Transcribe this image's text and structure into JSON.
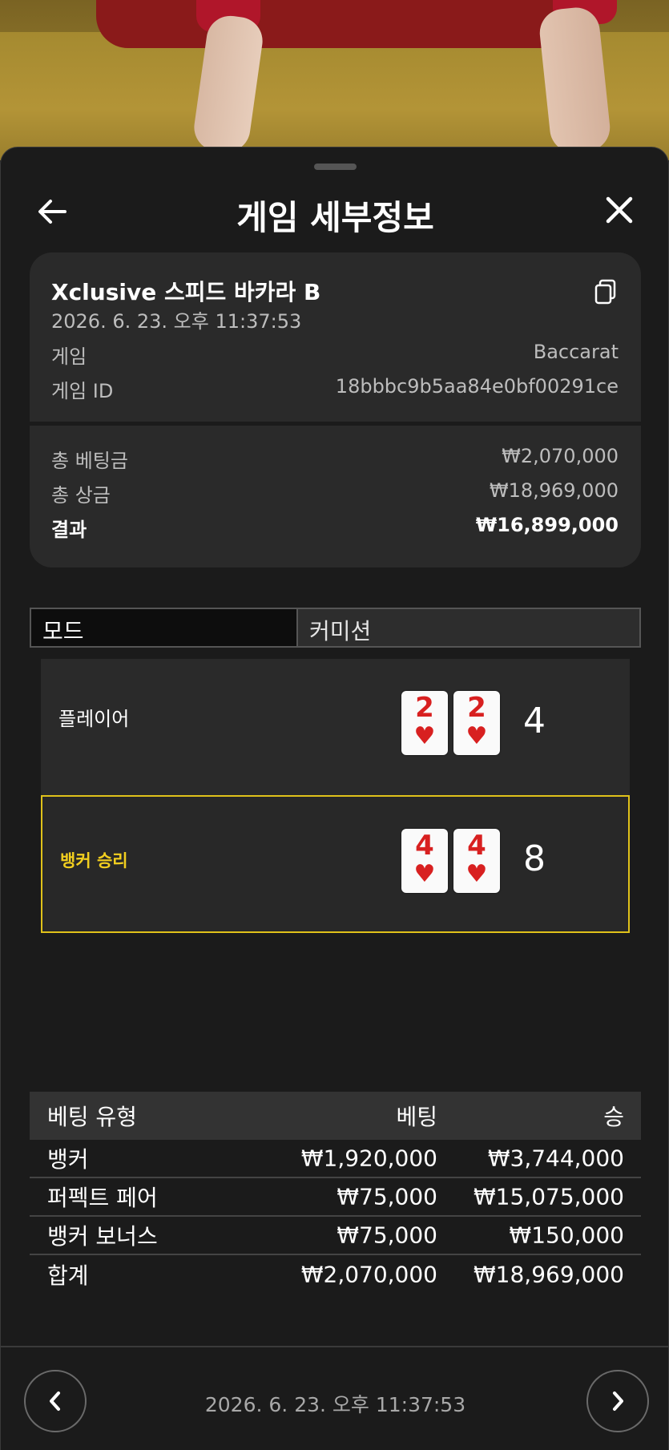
{
  "header": {
    "title": "게임 세부정보"
  },
  "info": {
    "game_name": "Xclusive 스피드 바카라 B",
    "datetime": "2026. 6. 23. 오후 11:37:53",
    "game_label": "게임",
    "game_value": "Baccarat",
    "game_id_label": "게임 ID",
    "game_id_value": "18bbbc9b5aa84e0bf00291ce"
  },
  "summary": {
    "total_bet_label": "총 베팅금",
    "total_bet_value": "₩2,070,000",
    "total_win_label": "총 상금",
    "total_win_value": "₩18,969,000",
    "result_label": "결과",
    "result_value": "₩16,899,000"
  },
  "tabs": [
    {
      "label": "모드",
      "active": true
    },
    {
      "label": "커미션",
      "active": false
    }
  ],
  "result": {
    "player": {
      "label": "플레이어",
      "cards": [
        {
          "rank": "2",
          "suit": "♥"
        },
        {
          "rank": "2",
          "suit": "♥"
        }
      ],
      "score": "4"
    },
    "banker": {
      "label": "뱅커 승리",
      "cards": [
        {
          "rank": "4",
          "suit": "♥"
        },
        {
          "rank": "4",
          "suit": "♥"
        }
      ],
      "score": "8"
    },
    "win_color": "#e0c21a"
  },
  "bets": {
    "headers": {
      "type": "베팅 유형",
      "bet": "베팅",
      "win": "승"
    },
    "rows": [
      {
        "type": "뱅커",
        "bet": "₩1,920,000",
        "win": "₩3,744,000"
      },
      {
        "type": "퍼펙트 페어",
        "bet": "₩75,000",
        "win": "₩15,075,000"
      },
      {
        "type": "뱅커 보너스",
        "bet": "₩75,000",
        "win": "₩150,000"
      }
    ],
    "total": {
      "type": "합계",
      "bet": "₩2,070,000",
      "win": "₩18,969,000"
    }
  },
  "footer": {
    "datetime": "2026. 6. 23. 오후 11:37:53"
  }
}
